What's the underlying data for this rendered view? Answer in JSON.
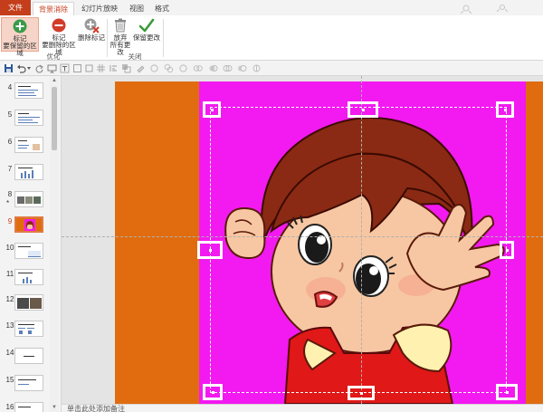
{
  "tabs": [
    {
      "label": "文件",
      "kind": "file"
    },
    {
      "label": "背景消除",
      "kind": "active"
    },
    {
      "label": "幻灯片放映",
      "kind": "normal"
    },
    {
      "label": "视图",
      "kind": "normal"
    },
    {
      "label": "格式",
      "kind": "normal"
    }
  ],
  "ribbon": {
    "groups": [
      {
        "label": "优化"
      },
      {
        "label": "关闭"
      }
    ],
    "buttons": [
      {
        "line1": "标记",
        "line2": "要保留的区域",
        "icon": "plus-circle-icon"
      },
      {
        "line1": "标记",
        "line2": "要删除的区域",
        "icon": "minus-circle-icon"
      },
      {
        "line1": "删除标记",
        "line2": "",
        "icon": "delete-mark-icon"
      },
      {
        "line1": "放弃",
        "line2": "所有更改",
        "icon": "discard-icon"
      },
      {
        "line1": "保留更改",
        "line2": "",
        "icon": "checkmark-icon"
      }
    ]
  },
  "thumbnails": [
    {
      "num": "4",
      "selected": false,
      "star": false
    },
    {
      "num": "5",
      "selected": false,
      "star": false
    },
    {
      "num": "6",
      "selected": false,
      "star": false
    },
    {
      "num": "7",
      "selected": false,
      "star": false
    },
    {
      "num": "8",
      "selected": false,
      "star": true
    },
    {
      "num": "9",
      "selected": true,
      "star": false
    },
    {
      "num": "10",
      "selected": false,
      "star": false
    },
    {
      "num": "11",
      "selected": false,
      "star": false
    },
    {
      "num": "12",
      "selected": false,
      "star": false
    },
    {
      "num": "13",
      "selected": false,
      "star": false
    },
    {
      "num": "14",
      "selected": false,
      "star": false
    },
    {
      "num": "15",
      "selected": false,
      "star": false
    },
    {
      "num": "16",
      "selected": false,
      "star": false
    }
  ],
  "thumb_star": "*",
  "notes_placeholder": "单击此处添加备注",
  "colors": {
    "accent": "#c43e1c",
    "slide_background": "#e06c0f",
    "keep_area": "#f21af0",
    "check_green": "#3a9a3a",
    "plus_green": "#3a9a4a",
    "minus_red": "#d23c2a"
  }
}
